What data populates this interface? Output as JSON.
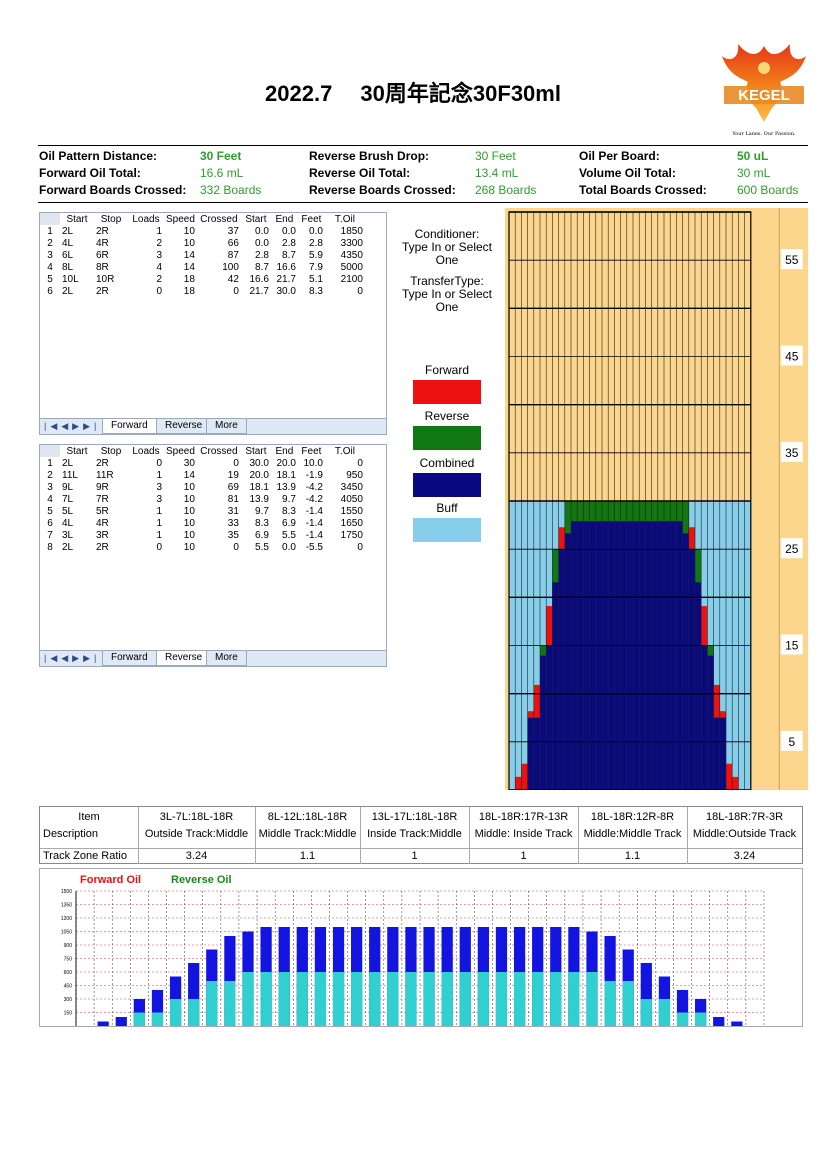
{
  "title": "2022.7　 30周年記念30F30ml",
  "logo": {
    "text": "KEGEL",
    "tagline": "Your Lanes. Our Passion."
  },
  "summary": {
    "pattern_distance_label": "Oil Pattern Distance:",
    "pattern_distance": "30 Feet",
    "fwd_oil_total_label": "Forward Oil Total:",
    "fwd_oil_total": "16.6 mL",
    "fwd_boards_label": "Forward Boards Crossed:",
    "fwd_boards": "332 Boards",
    "rev_brush_drop_label": "Reverse Brush Drop:",
    "rev_brush_drop": "30 Feet",
    "rev_oil_total_label": "Reverse Oil Total:",
    "rev_oil_total": "13.4 mL",
    "rev_boards_label": "Reverse Boards Crossed:",
    "rev_boards": "268 Boards",
    "oil_per_board_label": "Oil Per Board:",
    "oil_per_board": "50 uL",
    "volume_label": "Volume Oil Total:",
    "volume": "30 mL",
    "total_boards_label": "Total Boards Crossed:",
    "total_boards": "600 Boards"
  },
  "columns": [
    "Start",
    "Stop",
    "Loads",
    "Speed",
    "Crossed",
    "Start",
    "End",
    "Feet",
    "T.Oil"
  ],
  "forward": {
    "rows": [
      [
        "2L",
        "2R",
        "1",
        "10",
        "37",
        "0.0",
        "0.0",
        "0.0",
        "1850"
      ],
      [
        "4L",
        "4R",
        "2",
        "10",
        "66",
        "0.0",
        "2.8",
        "2.8",
        "3300"
      ],
      [
        "6L",
        "6R",
        "3",
        "14",
        "87",
        "2.8",
        "8.7",
        "5.9",
        "4350"
      ],
      [
        "8L",
        "8R",
        "4",
        "14",
        "100",
        "8.7",
        "16.6",
        "7.9",
        "5000"
      ],
      [
        "10L",
        "10R",
        "2",
        "18",
        "42",
        "16.6",
        "21.7",
        "5.1",
        "2100"
      ],
      [
        "2L",
        "2R",
        "0",
        "18",
        "0",
        "21.7",
        "30.0",
        "8.3",
        "0"
      ]
    ],
    "tabs": [
      "Forward",
      "Reverse",
      "More"
    ]
  },
  "reverse": {
    "rows": [
      [
        "2L",
        "2R",
        "0",
        "30",
        "0",
        "30.0",
        "20.0",
        "10.0",
        "0"
      ],
      [
        "11L",
        "11R",
        "1",
        "14",
        "19",
        "20.0",
        "18.1",
        "-1.9",
        "950"
      ],
      [
        "9L",
        "9R",
        "3",
        "10",
        "69",
        "18.1",
        "13.9",
        "-4.2",
        "3450"
      ],
      [
        "7L",
        "7R",
        "3",
        "10",
        "81",
        "13.9",
        "9.7",
        "-4.2",
        "4050"
      ],
      [
        "5L",
        "5R",
        "1",
        "10",
        "31",
        "9.7",
        "8.3",
        "-1.4",
        "1550"
      ],
      [
        "4L",
        "4R",
        "1",
        "10",
        "33",
        "8.3",
        "6.9",
        "-1.4",
        "1650"
      ],
      [
        "3L",
        "3R",
        "1",
        "10",
        "35",
        "6.9",
        "5.5",
        "-1.4",
        "1750"
      ],
      [
        "2L",
        "2R",
        "0",
        "10",
        "0",
        "5.5",
        "0.0",
        "-5.5",
        "0"
      ]
    ],
    "tabs": [
      "Forward",
      "Reverse",
      "More"
    ]
  },
  "side": {
    "conditioner": [
      "Conditioner:",
      "Type In or Select",
      "One"
    ],
    "transfer": [
      "TransferType:",
      "Type In or Select",
      "One"
    ]
  },
  "legend": [
    {
      "label": "Forward",
      "color": "#ee1111"
    },
    {
      "label": "Reverse",
      "color": "#117711"
    },
    {
      "label": "Combined",
      "color": "#0a0a80"
    },
    {
      "label": "Buff",
      "color": "#87ceeb"
    }
  ],
  "lane_labels": [
    "55",
    "45",
    "35",
    "25",
    "15",
    "5"
  ],
  "ratio": {
    "item_label": "Item",
    "description_label": "Description",
    "ratio_label": "Track Zone Ratio",
    "cols": [
      {
        "item": "3L-7L:18L-18R",
        "desc": "Outside Track:Middle",
        "ratio": "3.24"
      },
      {
        "item": "8L-12L:18L-18R",
        "desc": "Middle Track:Middle",
        "ratio": "1.1"
      },
      {
        "item": "13L-17L:18L-18R",
        "desc": "Inside Track:Middle",
        "ratio": "1"
      },
      {
        "item": "18L-18R:17R-13R",
        "desc": "Middle: Inside Track",
        "ratio": "1"
      },
      {
        "item": "18L-18R:12R-8R",
        "desc": "Middle:Middle Track",
        "ratio": "1.1"
      },
      {
        "item": "18L-18R:7R-3R",
        "desc": "Middle:Outside Track",
        "ratio": "3.24"
      }
    ]
  },
  "chart_data": {
    "type": "bar",
    "legend": [
      "Forward Oil",
      "Reverse Oil"
    ],
    "colors": {
      "forward": "#1414e0",
      "reverse": "#30d0d0"
    },
    "ylim": [
      0,
      1500
    ],
    "yticks": [
      "1500",
      "1350",
      "1200",
      "1050",
      "900",
      "750",
      "600",
      "450",
      "300",
      "150"
    ],
    "forward": [
      0,
      50,
      100,
      300,
      400,
      550,
      700,
      850,
      1000,
      1050,
      1100,
      1100,
      1100,
      1100,
      1100,
      1100,
      1100,
      1100,
      1100,
      1100,
      1100,
      1100,
      1100,
      1100,
      1100,
      1100,
      1100,
      1100,
      1050,
      1000,
      850,
      700,
      550,
      400,
      300,
      100,
      50,
      0
    ],
    "reverse": [
      0,
      0,
      0,
      150,
      150,
      300,
      300,
      500,
      500,
      600,
      600,
      600,
      600,
      600,
      600,
      600,
      600,
      600,
      600,
      600,
      600,
      600,
      600,
      600,
      600,
      600,
      600,
      600,
      600,
      500,
      500,
      300,
      300,
      150,
      150,
      0,
      0,
      0
    ]
  }
}
